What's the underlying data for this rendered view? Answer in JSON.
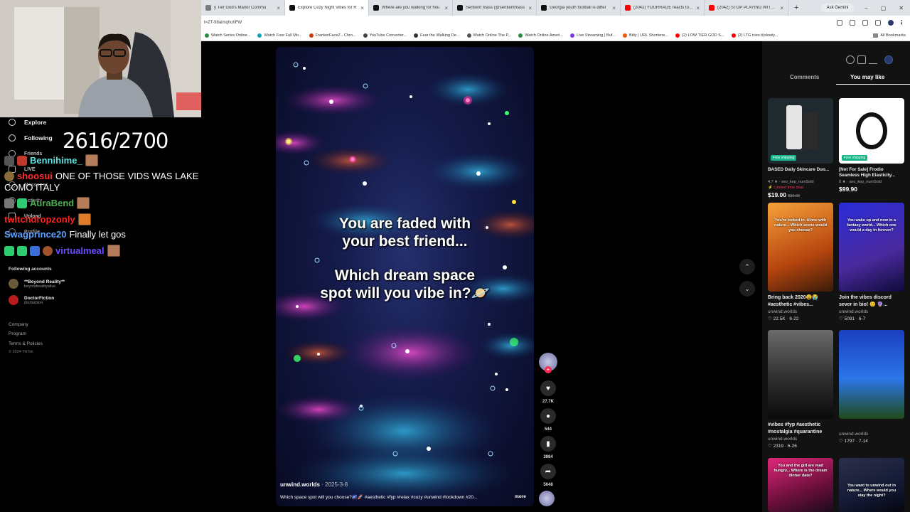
{
  "browser": {
    "tabs": [
      {
        "label": "y Tier God's Manor Commu",
        "color": "#7a7a7a"
      },
      {
        "label": "Explore Cozy Night Vibes for R",
        "color": "#111111"
      },
      {
        "label": "Where are you walking for hou",
        "color": "#111111"
      },
      {
        "label": "Sentient mass (@sentientmass",
        "color": "#111111"
      },
      {
        "label": "Georgia youth football is differ",
        "color": "#111111"
      },
      {
        "label": "(2042) YOURRAGE reacts to TA",
        "color": "#ff0000"
      },
      {
        "label": "(2042) STOP PLAYING WITH US",
        "color": "#ff0000"
      }
    ],
    "active_tab_index": 1,
    "ask_gemini": "Ask Gemini",
    "url": "t=ZT-98aimqhohFW",
    "bookmarks": [
      {
        "label": "Watch Series Online...",
        "color": "#2b8a3e"
      },
      {
        "label": "Watch Free Full Mo...",
        "color": "#17a2b8"
      },
      {
        "label": "FrankerFaceZ - Chro...",
        "color": "#c2410c"
      },
      {
        "label": "YouTube Converter...",
        "color": "#444444"
      },
      {
        "label": "Fear the Walking De...",
        "color": "#333333"
      },
      {
        "label": "Watch Online The P...",
        "color": "#555555"
      },
      {
        "label": "Watch Online Ameri...",
        "color": "#2b8a3e"
      },
      {
        "label": "Live Streaming | Buf...",
        "color": "#7c3aed"
      },
      {
        "label": "Bitly | URL Shortene...",
        "color": "#ea580c"
      },
      {
        "label": "(2) LOW TIER GOD S...",
        "color": "#ff0000"
      },
      {
        "label": "(2) LTG tries it(slowly...",
        "color": "#ff0000"
      }
    ],
    "all_bookmarks": "All Bookmarks"
  },
  "sidebar": {
    "items": [
      {
        "label": "Explore"
      },
      {
        "label": "Following"
      },
      {
        "label": "Friends"
      },
      {
        "label": "LIVE"
      },
      {
        "label": "Messages"
      },
      {
        "label": "Activity"
      },
      {
        "label": "Upload"
      },
      {
        "label": "Profile"
      }
    ],
    "following_title": "Following accounts",
    "following_accounts": [
      {
        "name": "**Beyond Reality**",
        "handle": "beyondrealityalive",
        "color": "#6b5a3a"
      },
      {
        "name": "DoctorFiction",
        "handle": "docfaiction",
        "color": "#b91c1c"
      }
    ],
    "footer": [
      "Company",
      "Program",
      "Terms & Policies",
      "© 2024 TikTok"
    ]
  },
  "overlay": {
    "counter": "2616/2700",
    "chat": [
      {
        "user": "Bennihime_",
        "user_color": "#5fe3e0",
        "message": ""
      },
      {
        "user": "shoosui",
        "user_color": "#ff2d2d",
        "message": "ONE OF THOSE VIDS WAS LAKE"
      },
      {
        "user": "",
        "user_color": "#ffffff",
        "message": "COMO ITALY"
      },
      {
        "user": "AuraBend",
        "user_color": "#4caf50",
        "message": ""
      },
      {
        "user": "twitchdropzonly",
        "user_color": "#ff2020",
        "message": ""
      },
      {
        "user": "Swagprince20",
        "user_color": "#5aa0ff",
        "message": "Finally let gos"
      },
      {
        "user": "virtualmeal",
        "user_color": "#6a4dff",
        "message": ""
      }
    ]
  },
  "video": {
    "caption_line1": "You are faded with",
    "caption_line2": "your best friend...",
    "caption_line3": "Which dream space",
    "caption_line4": "spot will you vibe in?🪐",
    "author": "unwind.worlds",
    "date": "· 2025-3-8",
    "description": "Which space spot will you choose?🌌🚀 #aesthetic #fyp #relax #cozy #unwind #lockdown #20...",
    "more": "more",
    "actions": {
      "likes": "27.7K",
      "comments": "544",
      "saves": "3984",
      "shares": "5648"
    }
  },
  "right_panel": {
    "tab_comments": "Comments",
    "tab_you_may_like": "You may like",
    "products": [
      {
        "title": "BASED Daily Skincare Duo...",
        "rating": "4.7 ★ · seo_kep_numSold",
        "deal": "⚡ Limited time deal",
        "price": "$19.00",
        "old_price": "$30.00",
        "badge": "Free shipping",
        "bg": "#1e2a2e"
      },
      {
        "title": "[Not For Sale] Frodio Seamless High Elasticity...",
        "rating": "0 ★ · seo_kep_numSold",
        "deal": "",
        "price": "$99.90",
        "old_price": "",
        "badge": "Free shipping",
        "bg": "#ffffff"
      }
    ],
    "videos": [
      {
        "title": "Bring back 2020😩😭 #aesthetic #vibes...",
        "author": "unwind.worlds",
        "stats": "♡ 22.5K · 6-22",
        "overlay": "You're locked in. Alone with nature... Which scene would you choose?",
        "grad": "linear-gradient(160deg,#f6a13a,#b8460f 60%,#3b1b08)"
      },
      {
        "title": "Join the vibes discord sever in bio! 😊 🔮...",
        "author": "unwind.worlds",
        "stats": "♡ 5091 · 6-7",
        "overlay": "You wake up and now in a fantasy world... Which one would a day in forever?",
        "grad": "linear-gradient(160deg,#2a2cd8,#4b2a9e 60%,#0e0b3a)"
      },
      {
        "title": "#vibes #fyp #aesthetic #nostalgia #quarantine",
        "author": "unwind.worlds",
        "stats": "♡ 2319 · 6-26",
        "overlay": "",
        "grad": "linear-gradient(180deg,#6b6b6b,#2e2e2e 55%,#0a0a0a)"
      },
      {
        "title": "",
        "author": "unwind.worlds",
        "stats": "♡ 1797 · 7-14",
        "overlay": "",
        "grad": "linear-gradient(180deg,#1b3fbf,#2b76e8 55%,#1f4a1a)"
      },
      {
        "title": "",
        "author": "",
        "stats": "",
        "overlay": "You and the girl are mad hungry... Where is the dream dinner date?",
        "grad": "linear-gradient(160deg,#e0277a,#6a0f3a 60%,#1c0a1a)"
      },
      {
        "title": "",
        "author": "",
        "stats": "",
        "overlay": "You want to unwind out in nature... Where would you stay the night?",
        "grad": "linear-gradient(160deg,#2b2f4a,#141a36 60%,#05060f)"
      }
    ]
  }
}
